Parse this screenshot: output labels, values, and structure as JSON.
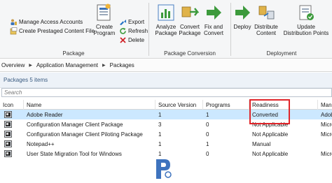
{
  "ribbon": {
    "manage_access": "Manage Access Accounts",
    "create_prestaged": "Create Prestaged Content File",
    "create_program": [
      "Create",
      "Program"
    ],
    "export": "Export",
    "refresh": "Refresh",
    "delete": "Delete",
    "package_group": "Package",
    "analyze_package": [
      "Analyze",
      "Package"
    ],
    "convert_package": [
      "Convert",
      "Package"
    ],
    "fix_and_convert": [
      "Fix and",
      "Convert"
    ],
    "conversion_group": "Package Conversion",
    "deploy": "Deploy",
    "distribute_content": [
      "Distribute",
      "Content"
    ],
    "update_distribution": [
      "Update",
      "Distribution Points"
    ],
    "deployment_group": "Deployment"
  },
  "breadcrumb": [
    "Overview",
    "Application Management",
    "Packages"
  ],
  "list_header": "Packages 5 items",
  "search": {
    "placeholder": "Search"
  },
  "table": {
    "columns": [
      "Icon",
      "Name",
      "Source Version",
      "Programs",
      "Readiness",
      "Manu"
    ],
    "rows": [
      {
        "name": "Adobe Reader",
        "source_version": "1",
        "programs": "1",
        "readiness": "Converted",
        "manufacturer": "Adob"
      },
      {
        "name": "Configuration Manager Client Package",
        "source_version": "3",
        "programs": "0",
        "readiness": "Not Applicable",
        "manufacturer": "Micro"
      },
      {
        "name": "Configuration Manager Client Piloting Package",
        "source_version": "1",
        "programs": "0",
        "readiness": "Not Applicable",
        "manufacturer": "Micro"
      },
      {
        "name": "Notepad++",
        "source_version": "1",
        "programs": "1",
        "readiness": "Manual",
        "manufacturer": ""
      },
      {
        "name": "User State Migration Tool for Windows",
        "source_version": "1",
        "programs": "0",
        "readiness": "Not Applicable",
        "manufacturer": "Micro"
      }
    ],
    "selected_row": 0
  },
  "colors": {
    "accent_blue": "#1e6fc4",
    "selection": "#cce8ff",
    "highlight_border": "#e0252a",
    "ribbon_green": "#3c9a3c"
  }
}
